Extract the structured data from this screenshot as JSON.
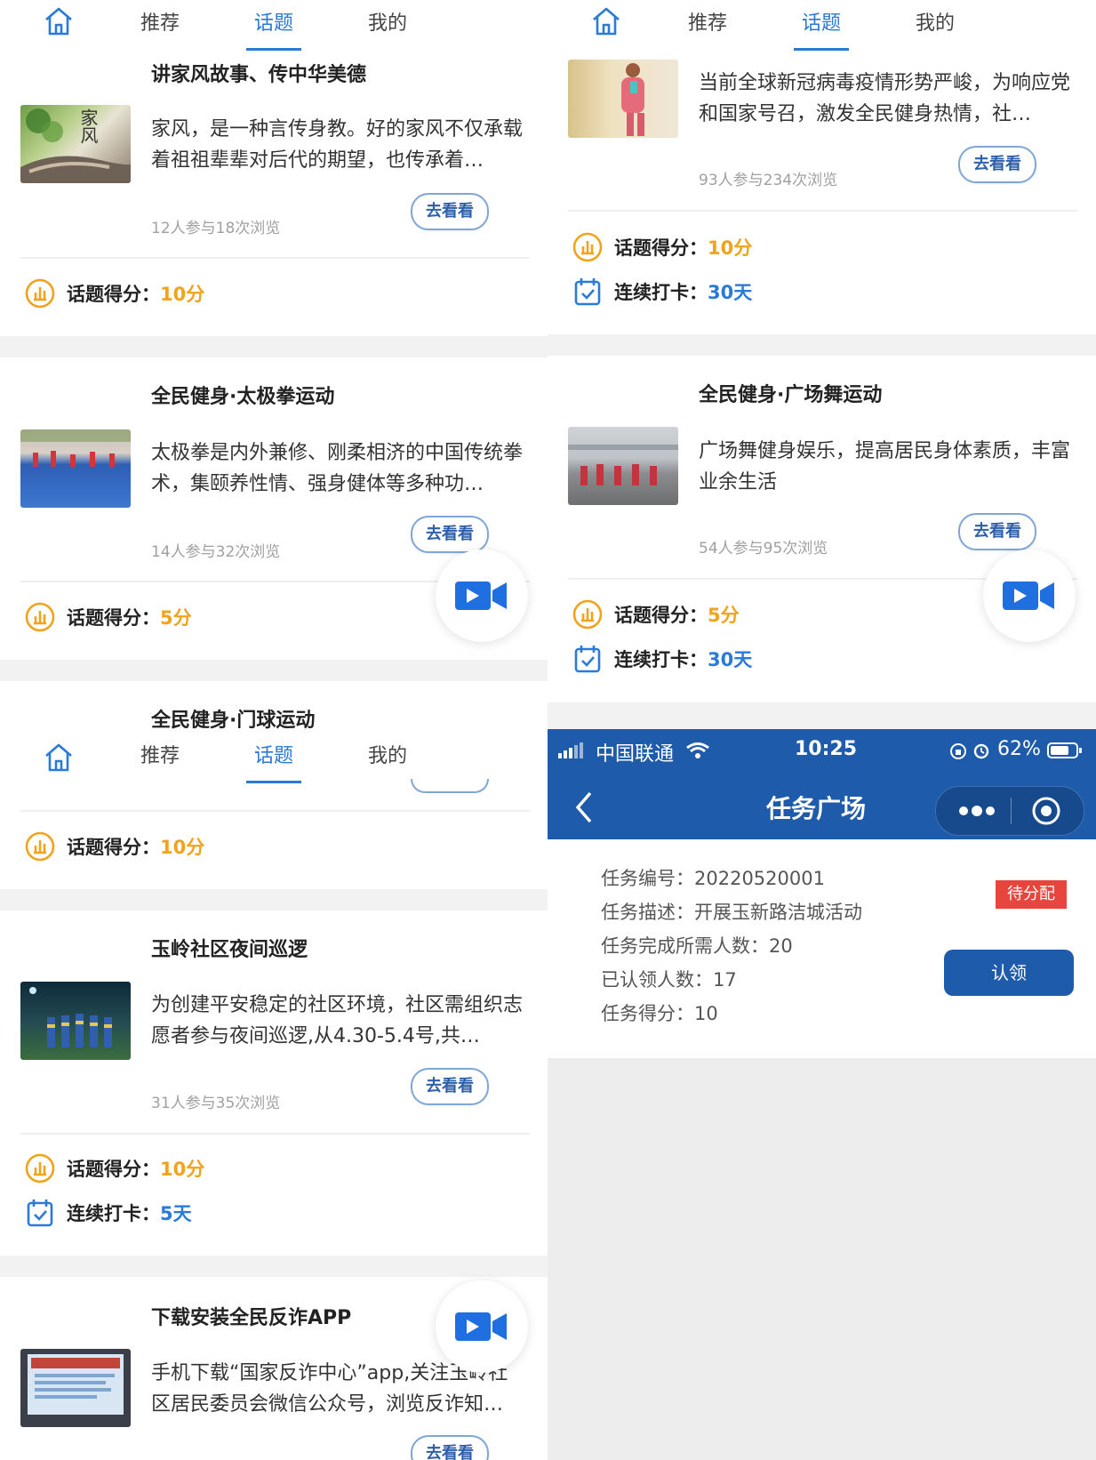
{
  "nav": {
    "home_label": "",
    "tab1": "推荐",
    "tab2": "话题",
    "tab3": "我的"
  },
  "colors": {
    "accent": "#2a7ad9",
    "score": "#f2a21b",
    "task_header": "#1e5bab",
    "badge": "#e8453c",
    "claim": "#1e5bab"
  },
  "left": {
    "card1": {
      "title": "讲家风故事、传中华美德",
      "desc": "家风，是一种言传身教。好的家风不仅承载着祖祖辈辈对后代的期望，也传承着…",
      "meta": "12人参与18次浏览",
      "btn": "去看看",
      "score_label": "话题得分：",
      "score_value": "10分"
    },
    "card2": {
      "title": "全民健身·太极拳运动",
      "desc": "太极拳是内外兼修、刚柔相济的中国传统拳术，集颐养性情、强身健体等多种功…",
      "meta": "14人参与32次浏览",
      "btn": "去看看",
      "score_label": "话题得分：",
      "score_value": "5分"
    },
    "card3": {
      "title": "全民健身·门球运动",
      "score_label": "话题得分：",
      "score_value": "10分"
    },
    "card4": {
      "title": "玉岭社区夜间巡逻",
      "desc": "为创建平安稳定的社区环境，社区需组织志愿者参与夜间巡逻,从4.30-5.4号,共…",
      "meta": "31人参与35次浏览",
      "btn": "去看看",
      "score_label": "话题得分：",
      "score_value": "10分",
      "streak_label": "连续打卡：",
      "streak_value": "5天"
    },
    "card5": {
      "title": "下载安装全民反诈APP",
      "desc": "手机下载“国家反诈中心”app,关注玉岭社区居民委员会微信公众号，浏览反诈知…",
      "btn": "去看看"
    }
  },
  "right": {
    "card1": {
      "desc": "当前全球新冠病毒疫情形势严峻，为响应党和国家号召，激发全民健身热情，社…",
      "meta": "93人参与234次浏览",
      "btn": "去看看",
      "score_label": "话题得分：",
      "score_value": "10分",
      "streak_label": "连续打卡：",
      "streak_value": "30天"
    },
    "card2": {
      "title": "全民健身·广场舞运动",
      "desc": "广场舞健身娱乐，提高居民身体素质，丰富业余生活",
      "meta": "54人参与95次浏览",
      "btn": "去看看",
      "score_label": "话题得分：",
      "score_value": "5分",
      "streak_label": "连续打卡：",
      "streak_value": "30天"
    }
  },
  "thumbs": {
    "card1_text": "家风"
  },
  "statusbar": {
    "carrier": "中国联通",
    "time": "10:25",
    "battery": "62%"
  },
  "task": {
    "page_title": "任务广场",
    "number_label": "任务编号：",
    "number_value": "20220520001",
    "desc_label": "任务描述：",
    "desc_value": "开展玉新路洁城活动",
    "need_label": "任务完成所需人数：",
    "need_value": "20",
    "claimed_label": "已认领人数：",
    "claimed_value": "17",
    "score_label": "任务得分：",
    "score_value": "10",
    "badge": "待分配",
    "claim_btn": "认领"
  }
}
